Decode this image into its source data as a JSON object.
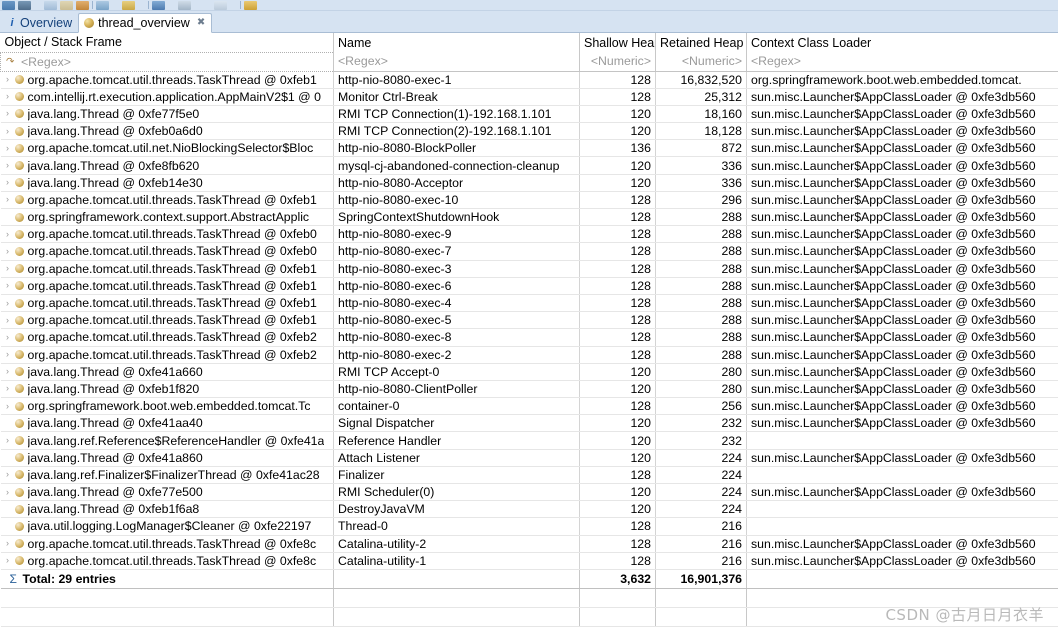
{
  "toolbar": {
    "icons": [
      {
        "name": "bullet-icon",
        "color": "#3a6ea5"
      },
      {
        "name": "histogram-icon",
        "color": "#4a6d91"
      },
      {
        "name": "dominator-tree-icon",
        "color": "#9ab6d4"
      },
      {
        "name": "report-icon",
        "color": "#c9b98a"
      },
      {
        "name": "oql-icon",
        "color": "#c98a3a"
      },
      {
        "name": "open-query-browser-icon",
        "color": "#7fa8c9"
      },
      {
        "name": "inspector-icon",
        "color": "#d4b45a"
      },
      {
        "name": "find-icon",
        "color": "#4a7fb5"
      },
      {
        "name": "export-icon",
        "color": "#a8b8c8"
      },
      {
        "name": "print-icon",
        "color": "#c8d4e0"
      },
      {
        "name": "settings-icon",
        "color": "#d8a83a"
      }
    ]
  },
  "tabs": [
    {
      "label": "Overview",
      "icon": "info-icon",
      "active": false,
      "closable": false
    },
    {
      "label": "thread_overview",
      "icon": "object-icon",
      "active": true,
      "closable": true
    }
  ],
  "tab_close_glyph": "✖",
  "table": {
    "columns": [
      {
        "key": "object",
        "header": "Object / Stack Frame",
        "filter": "<Regex>",
        "align": "left"
      },
      {
        "key": "name",
        "header": "Name",
        "filter": "<Regex>",
        "align": "left"
      },
      {
        "key": "shallow",
        "header": "Shallow Heap",
        "filter": "<Numeric>",
        "align": "right"
      },
      {
        "key": "retained",
        "header": "Retained Heap",
        "filter": "<Numeric>",
        "align": "right"
      },
      {
        "key": "loader",
        "header": "Context Class Loader",
        "filter": "<Regex>",
        "align": "left"
      }
    ],
    "expand_glyph": "›",
    "rows": [
      {
        "expandable": true,
        "object": "org.apache.tomcat.util.threads.TaskThread @ 0xfeb1",
        "name": "http-nio-8080-exec-1",
        "shallow": "128",
        "retained": "16,832,520",
        "loader": "org.springframework.boot.web.embedded.tomcat."
      },
      {
        "expandable": true,
        "object": "com.intellij.rt.execution.application.AppMainV2$1 @ 0",
        "name": "Monitor Ctrl-Break",
        "shallow": "128",
        "retained": "25,312",
        "loader": "sun.misc.Launcher$AppClassLoader @ 0xfe3db560"
      },
      {
        "expandable": true,
        "object": "java.lang.Thread @ 0xfe77f5e0",
        "name": "RMI TCP Connection(1)-192.168.1.101",
        "shallow": "120",
        "retained": "18,160",
        "loader": "sun.misc.Launcher$AppClassLoader @ 0xfe3db560"
      },
      {
        "expandable": true,
        "object": "java.lang.Thread @ 0xfeb0a6d0",
        "name": "RMI TCP Connection(2)-192.168.1.101",
        "shallow": "120",
        "retained": "18,128",
        "loader": "sun.misc.Launcher$AppClassLoader @ 0xfe3db560"
      },
      {
        "expandable": true,
        "object": "org.apache.tomcat.util.net.NioBlockingSelector$Bloc",
        "name": "http-nio-8080-BlockPoller",
        "shallow": "136",
        "retained": "872",
        "loader": "sun.misc.Launcher$AppClassLoader @ 0xfe3db560"
      },
      {
        "expandable": true,
        "object": "java.lang.Thread @ 0xfe8fb620",
        "name": "mysql-cj-abandoned-connection-cleanup",
        "shallow": "120",
        "retained": "336",
        "loader": "sun.misc.Launcher$AppClassLoader @ 0xfe3db560"
      },
      {
        "expandable": true,
        "object": "java.lang.Thread @ 0xfeb14e30",
        "name": "http-nio-8080-Acceptor",
        "shallow": "120",
        "retained": "336",
        "loader": "sun.misc.Launcher$AppClassLoader @ 0xfe3db560"
      },
      {
        "expandable": true,
        "object": "org.apache.tomcat.util.threads.TaskThread @ 0xfeb1",
        "name": "http-nio-8080-exec-10",
        "shallow": "128",
        "retained": "296",
        "loader": "sun.misc.Launcher$AppClassLoader @ 0xfe3db560"
      },
      {
        "expandable": false,
        "object": "org.springframework.context.support.AbstractApplic",
        "name": "SpringContextShutdownHook",
        "shallow": "128",
        "retained": "288",
        "loader": "sun.misc.Launcher$AppClassLoader @ 0xfe3db560"
      },
      {
        "expandable": true,
        "object": "org.apache.tomcat.util.threads.TaskThread @ 0xfeb0",
        "name": "http-nio-8080-exec-9",
        "shallow": "128",
        "retained": "288",
        "loader": "sun.misc.Launcher$AppClassLoader @ 0xfe3db560"
      },
      {
        "expandable": true,
        "object": "org.apache.tomcat.util.threads.TaskThread @ 0xfeb0",
        "name": "http-nio-8080-exec-7",
        "shallow": "128",
        "retained": "288",
        "loader": "sun.misc.Launcher$AppClassLoader @ 0xfe3db560"
      },
      {
        "expandable": true,
        "object": "org.apache.tomcat.util.threads.TaskThread @ 0xfeb1",
        "name": "http-nio-8080-exec-3",
        "shallow": "128",
        "retained": "288",
        "loader": "sun.misc.Launcher$AppClassLoader @ 0xfe3db560"
      },
      {
        "expandable": true,
        "object": "org.apache.tomcat.util.threads.TaskThread @ 0xfeb1",
        "name": "http-nio-8080-exec-6",
        "shallow": "128",
        "retained": "288",
        "loader": "sun.misc.Launcher$AppClassLoader @ 0xfe3db560"
      },
      {
        "expandable": true,
        "object": "org.apache.tomcat.util.threads.TaskThread @ 0xfeb1",
        "name": "http-nio-8080-exec-4",
        "shallow": "128",
        "retained": "288",
        "loader": "sun.misc.Launcher$AppClassLoader @ 0xfe3db560"
      },
      {
        "expandable": true,
        "object": "org.apache.tomcat.util.threads.TaskThread @ 0xfeb1",
        "name": "http-nio-8080-exec-5",
        "shallow": "128",
        "retained": "288",
        "loader": "sun.misc.Launcher$AppClassLoader @ 0xfe3db560"
      },
      {
        "expandable": true,
        "object": "org.apache.tomcat.util.threads.TaskThread @ 0xfeb2",
        "name": "http-nio-8080-exec-8",
        "shallow": "128",
        "retained": "288",
        "loader": "sun.misc.Launcher$AppClassLoader @ 0xfe3db560"
      },
      {
        "expandable": true,
        "object": "org.apache.tomcat.util.threads.TaskThread @ 0xfeb2",
        "name": "http-nio-8080-exec-2",
        "shallow": "128",
        "retained": "288",
        "loader": "sun.misc.Launcher$AppClassLoader @ 0xfe3db560"
      },
      {
        "expandable": true,
        "object": "java.lang.Thread @ 0xfe41a660",
        "name": "RMI TCP Accept-0",
        "shallow": "120",
        "retained": "280",
        "loader": "sun.misc.Launcher$AppClassLoader @ 0xfe3db560"
      },
      {
        "expandable": true,
        "object": "java.lang.Thread @ 0xfeb1f820",
        "name": "http-nio-8080-ClientPoller",
        "shallow": "120",
        "retained": "280",
        "loader": "sun.misc.Launcher$AppClassLoader @ 0xfe3db560"
      },
      {
        "expandable": true,
        "object": "org.springframework.boot.web.embedded.tomcat.Tc",
        "name": "container-0",
        "shallow": "128",
        "retained": "256",
        "loader": "sun.misc.Launcher$AppClassLoader @ 0xfe3db560"
      },
      {
        "expandable": false,
        "object": "java.lang.Thread @ 0xfe41aa40",
        "name": "Signal Dispatcher",
        "shallow": "120",
        "retained": "232",
        "loader": "sun.misc.Launcher$AppClassLoader @ 0xfe3db560"
      },
      {
        "expandable": true,
        "object": "java.lang.ref.Reference$ReferenceHandler @ 0xfe41a",
        "name": "Reference Handler",
        "shallow": "120",
        "retained": "232",
        "loader": ""
      },
      {
        "expandable": false,
        "object": "java.lang.Thread @ 0xfe41a860",
        "name": "Attach Listener",
        "shallow": "120",
        "retained": "224",
        "loader": "sun.misc.Launcher$AppClassLoader @ 0xfe3db560"
      },
      {
        "expandable": true,
        "object": "java.lang.ref.Finalizer$FinalizerThread @ 0xfe41ac28",
        "name": "Finalizer",
        "shallow": "128",
        "retained": "224",
        "loader": ""
      },
      {
        "expandable": true,
        "object": "java.lang.Thread @ 0xfe77e500",
        "name": "RMI Scheduler(0)",
        "shallow": "120",
        "retained": "224",
        "loader": "sun.misc.Launcher$AppClassLoader @ 0xfe3db560"
      },
      {
        "expandable": false,
        "object": "java.lang.Thread @ 0xfeb1f6a8",
        "name": "DestroyJavaVM",
        "shallow": "120",
        "retained": "224",
        "loader": ""
      },
      {
        "expandable": false,
        "object": "java.util.logging.LogManager$Cleaner @ 0xfe22197",
        "name": "Thread-0",
        "shallow": "128",
        "retained": "216",
        "loader": ""
      },
      {
        "expandable": true,
        "object": "org.apache.tomcat.util.threads.TaskThread @ 0xfe8c",
        "name": "Catalina-utility-2",
        "shallow": "128",
        "retained": "216",
        "loader": "sun.misc.Launcher$AppClassLoader @ 0xfe3db560"
      },
      {
        "expandable": true,
        "object": "org.apache.tomcat.util.threads.TaskThread @ 0xfe8c",
        "name": "Catalina-utility-1",
        "shallow": "128",
        "retained": "216",
        "loader": "sun.misc.Launcher$AppClassLoader @ 0xfe3db560"
      }
    ],
    "total": {
      "sigma_glyph": "Σ",
      "label": "Total: 29 entries",
      "name": "",
      "shallow": "3,632",
      "retained": "16,901,376",
      "loader": ""
    }
  },
  "watermark": "CSDN @古月日月衣羊"
}
